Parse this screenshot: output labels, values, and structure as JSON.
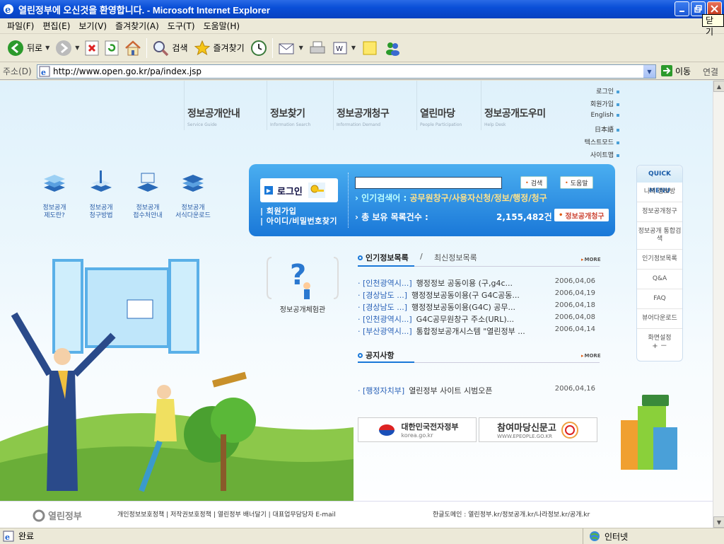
{
  "window": {
    "title": "열린정부에 오신것을 환영합니다. - Microsoft Internet Explorer",
    "close_tooltip": "닫기"
  },
  "menu": [
    "파일(F)",
    "편집(E)",
    "보기(V)",
    "즐겨찾기(A)",
    "도구(T)",
    "도움말(H)"
  ],
  "toolbar": {
    "back": "뒤로",
    "search": "검색",
    "favorites": "즐겨찾기"
  },
  "address": {
    "label": "주소(D)",
    "url": "http://www.open.go.kr/pa/index.jsp",
    "go": "이동",
    "links": "연결"
  },
  "gnb": [
    {
      "ko": "정보공개안내",
      "en": "Service Guide"
    },
    {
      "ko": "정보찾기",
      "en": "Information Search"
    },
    {
      "ko": "정보공개청구",
      "en": "Information Demand"
    },
    {
      "ko": "열린마당",
      "en": "People Participation"
    },
    {
      "ko": "정보공개도우미",
      "en": "Help Desk"
    }
  ],
  "util_links": [
    "로그인",
    "회원가입",
    "English",
    "日本語",
    "텍스트모드",
    "사이트맵"
  ],
  "guides": [
    {
      "l1": "정보공개",
      "l2": "제도란?"
    },
    {
      "l1": "정보공개",
      "l2": "청구방법"
    },
    {
      "l1": "정보공개",
      "l2": "접수처안내"
    },
    {
      "l1": "정보공개",
      "l2": "서식다운로드"
    }
  ],
  "login": {
    "button": "로그인",
    "join": "회원가입",
    "find": "아이디/비밀번호찾기",
    "search_btn": "검색",
    "help_btn": "도움말",
    "popular_label": "인기검색어 :",
    "popular_value": "공무원창구/사용자신청/정보/행정/청구",
    "total_label": "총 보유 목록건수 :",
    "total_value": "2,155,482건",
    "request_btn": "정보공개청구"
  },
  "quick_menu": {
    "title": "QUICK MENU",
    "items": [
      "나의 정보방",
      "정보공개청구",
      "정보공개 통합검색",
      "인기정보목록",
      "Q&A",
      "FAQ",
      "뷰어다운로드"
    ],
    "setting": "화면설정",
    "plus": "+",
    "minus": "－"
  },
  "experience": "정보공개체험관",
  "lists": {
    "tab_popular": "인기정보목록",
    "tab_sep": "/",
    "tab_recent": "최신정보목록",
    "more": "MORE",
    "popular_rows": [
      {
        "cat": "· [인천광역시...]",
        "subj": "행정정보 공동이용 (구,g4c...",
        "date": "2006,04,06"
      },
      {
        "cat": "· [경상남도 ...]",
        "subj": "행정정보공동이용(구 G4C공동...",
        "date": "2006,04,19"
      },
      {
        "cat": "· [경상남도 ...]",
        "subj": "행정정보공동이용(G4C) 공무...",
        "date": "2006,04,18"
      },
      {
        "cat": "· [인천광역시...]",
        "subj": "G4C공무원창구 주소(URL)...",
        "date": "2006,04,08"
      },
      {
        "cat": "· [부산광역시...]",
        "subj": "통합정보공개시스템 \"열린정부 ...",
        "date": "2006,04,14"
      }
    ],
    "notice_title": "공지사항",
    "notice_rows": [
      {
        "cat": "· [행정자치부]",
        "subj": "열린정부 사이트 시범오픈",
        "date": "2006,04,16"
      }
    ]
  },
  "banners": [
    {
      "title": "대한민국전자정부",
      "sub": "korea.go.kr"
    },
    {
      "title": "참여마당신문고",
      "sub": "WWW.EPEOPLE.GO.KR"
    }
  ],
  "footer": {
    "logo": "열린정부",
    "links": "개인정보보호정책 | 저작권보호정책 | 열린정부 배너달기 | 대표업무담당자 E-mail",
    "domain": "한글도메인 : 열린정부.kr/정보공개.kr/나라정보.kr/공개.kr"
  },
  "status": {
    "text": "완료",
    "zone": "인터넷"
  },
  "colors": {
    "accent": "#1a78d8",
    "title_bar": "#0a4fd8"
  }
}
